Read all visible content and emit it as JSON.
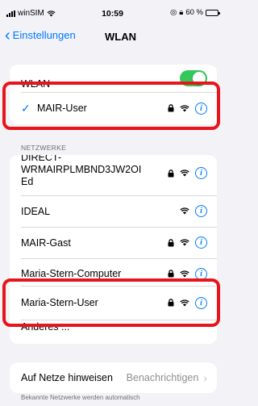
{
  "status_bar": {
    "carrier": "winSIM",
    "time": "10:59",
    "battery_text": "60 %"
  },
  "nav": {
    "back_label": "Einstellungen",
    "title": "WLAN"
  },
  "wlan_group": {
    "wlan_label": "WLAN",
    "wlan_enabled": true,
    "connected_network": "MAIR-User"
  },
  "networks": {
    "header": "NETZWERKE",
    "items": [
      {
        "name": "DIRECT-WRMAIRPLMBND3JW2OI Ed",
        "lines": [
          "DIRECT-",
          "WRMAIRPLMBND3JW2OI",
          "Ed"
        ],
        "locked": true
      },
      {
        "name": "IDEAL",
        "locked": false
      },
      {
        "name": "MAIR-Gast",
        "locked": true
      },
      {
        "name": "Maria-Stern-Computer",
        "locked": true
      },
      {
        "name": "Maria-Stern-User",
        "locked": true
      },
      {
        "name": "Anderes ..."
      }
    ]
  },
  "ask_to_join": {
    "label": "Auf Netze hinweisen",
    "value": "Benachrichtigen",
    "footnote": "Bekannte Netzwerke werden automatisch"
  },
  "colors": {
    "accent": "#007aff",
    "toggle_on": "#34c759",
    "highlight": "#e8141c",
    "background": "#f2f2f7"
  }
}
